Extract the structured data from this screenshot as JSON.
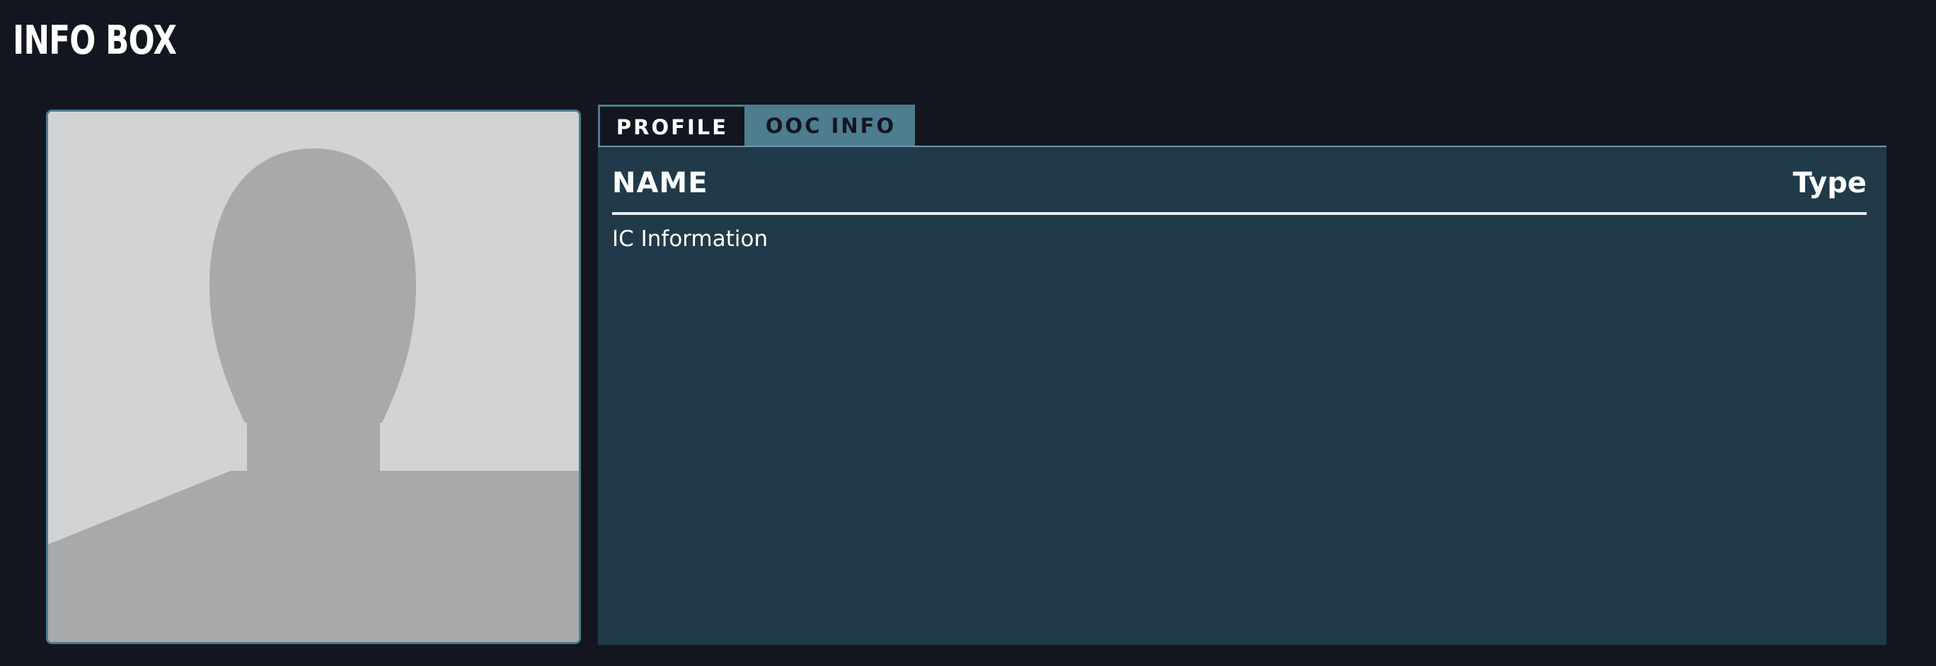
{
  "title": "INFO BOX",
  "avatar": {
    "icon": "person-silhouette-icon",
    "background": "#d2d3d5",
    "silhouette": "#a8a9ab"
  },
  "tabs": [
    {
      "label": "PROFILE",
      "active": true
    },
    {
      "label": "OOC INFO",
      "active": false
    }
  ],
  "panel": {
    "name": "NAME",
    "type": "Type",
    "content": "IC Information"
  },
  "colors": {
    "page_background": "#13161e",
    "panel_background": "#203a4a",
    "accent": "#4d7d8e",
    "text": "#ffffff"
  }
}
